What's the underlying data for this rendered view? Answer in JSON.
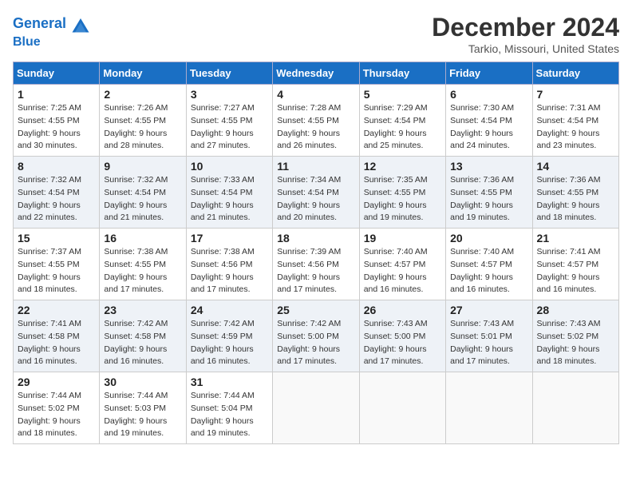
{
  "header": {
    "logo_line1": "General",
    "logo_line2": "Blue",
    "month_title": "December 2024",
    "location": "Tarkio, Missouri, United States"
  },
  "days_of_week": [
    "Sunday",
    "Monday",
    "Tuesday",
    "Wednesday",
    "Thursday",
    "Friday",
    "Saturday"
  ],
  "weeks": [
    [
      {
        "day": 1,
        "sunrise": "Sunrise: 7:25 AM",
        "sunset": "Sunset: 4:55 PM",
        "daylight": "Daylight: 9 hours and 30 minutes."
      },
      {
        "day": 2,
        "sunrise": "Sunrise: 7:26 AM",
        "sunset": "Sunset: 4:55 PM",
        "daylight": "Daylight: 9 hours and 28 minutes."
      },
      {
        "day": 3,
        "sunrise": "Sunrise: 7:27 AM",
        "sunset": "Sunset: 4:55 PM",
        "daylight": "Daylight: 9 hours and 27 minutes."
      },
      {
        "day": 4,
        "sunrise": "Sunrise: 7:28 AM",
        "sunset": "Sunset: 4:55 PM",
        "daylight": "Daylight: 9 hours and 26 minutes."
      },
      {
        "day": 5,
        "sunrise": "Sunrise: 7:29 AM",
        "sunset": "Sunset: 4:54 PM",
        "daylight": "Daylight: 9 hours and 25 minutes."
      },
      {
        "day": 6,
        "sunrise": "Sunrise: 7:30 AM",
        "sunset": "Sunset: 4:54 PM",
        "daylight": "Daylight: 9 hours and 24 minutes."
      },
      {
        "day": 7,
        "sunrise": "Sunrise: 7:31 AM",
        "sunset": "Sunset: 4:54 PM",
        "daylight": "Daylight: 9 hours and 23 minutes."
      }
    ],
    [
      {
        "day": 8,
        "sunrise": "Sunrise: 7:32 AM",
        "sunset": "Sunset: 4:54 PM",
        "daylight": "Daylight: 9 hours and 22 minutes."
      },
      {
        "day": 9,
        "sunrise": "Sunrise: 7:32 AM",
        "sunset": "Sunset: 4:54 PM",
        "daylight": "Daylight: 9 hours and 21 minutes."
      },
      {
        "day": 10,
        "sunrise": "Sunrise: 7:33 AM",
        "sunset": "Sunset: 4:54 PM",
        "daylight": "Daylight: 9 hours and 21 minutes."
      },
      {
        "day": 11,
        "sunrise": "Sunrise: 7:34 AM",
        "sunset": "Sunset: 4:54 PM",
        "daylight": "Daylight: 9 hours and 20 minutes."
      },
      {
        "day": 12,
        "sunrise": "Sunrise: 7:35 AM",
        "sunset": "Sunset: 4:55 PM",
        "daylight": "Daylight: 9 hours and 19 minutes."
      },
      {
        "day": 13,
        "sunrise": "Sunrise: 7:36 AM",
        "sunset": "Sunset: 4:55 PM",
        "daylight": "Daylight: 9 hours and 19 minutes."
      },
      {
        "day": 14,
        "sunrise": "Sunrise: 7:36 AM",
        "sunset": "Sunset: 4:55 PM",
        "daylight": "Daylight: 9 hours and 18 minutes."
      }
    ],
    [
      {
        "day": 15,
        "sunrise": "Sunrise: 7:37 AM",
        "sunset": "Sunset: 4:55 PM",
        "daylight": "Daylight: 9 hours and 18 minutes."
      },
      {
        "day": 16,
        "sunrise": "Sunrise: 7:38 AM",
        "sunset": "Sunset: 4:55 PM",
        "daylight": "Daylight: 9 hours and 17 minutes."
      },
      {
        "day": 17,
        "sunrise": "Sunrise: 7:38 AM",
        "sunset": "Sunset: 4:56 PM",
        "daylight": "Daylight: 9 hours and 17 minutes."
      },
      {
        "day": 18,
        "sunrise": "Sunrise: 7:39 AM",
        "sunset": "Sunset: 4:56 PM",
        "daylight": "Daylight: 9 hours and 17 minutes."
      },
      {
        "day": 19,
        "sunrise": "Sunrise: 7:40 AM",
        "sunset": "Sunset: 4:57 PM",
        "daylight": "Daylight: 9 hours and 16 minutes."
      },
      {
        "day": 20,
        "sunrise": "Sunrise: 7:40 AM",
        "sunset": "Sunset: 4:57 PM",
        "daylight": "Daylight: 9 hours and 16 minutes."
      },
      {
        "day": 21,
        "sunrise": "Sunrise: 7:41 AM",
        "sunset": "Sunset: 4:57 PM",
        "daylight": "Daylight: 9 hours and 16 minutes."
      }
    ],
    [
      {
        "day": 22,
        "sunrise": "Sunrise: 7:41 AM",
        "sunset": "Sunset: 4:58 PM",
        "daylight": "Daylight: 9 hours and 16 minutes."
      },
      {
        "day": 23,
        "sunrise": "Sunrise: 7:42 AM",
        "sunset": "Sunset: 4:58 PM",
        "daylight": "Daylight: 9 hours and 16 minutes."
      },
      {
        "day": 24,
        "sunrise": "Sunrise: 7:42 AM",
        "sunset": "Sunset: 4:59 PM",
        "daylight": "Daylight: 9 hours and 16 minutes."
      },
      {
        "day": 25,
        "sunrise": "Sunrise: 7:42 AM",
        "sunset": "Sunset: 5:00 PM",
        "daylight": "Daylight: 9 hours and 17 minutes."
      },
      {
        "day": 26,
        "sunrise": "Sunrise: 7:43 AM",
        "sunset": "Sunset: 5:00 PM",
        "daylight": "Daylight: 9 hours and 17 minutes."
      },
      {
        "day": 27,
        "sunrise": "Sunrise: 7:43 AM",
        "sunset": "Sunset: 5:01 PM",
        "daylight": "Daylight: 9 hours and 17 minutes."
      },
      {
        "day": 28,
        "sunrise": "Sunrise: 7:43 AM",
        "sunset": "Sunset: 5:02 PM",
        "daylight": "Daylight: 9 hours and 18 minutes."
      }
    ],
    [
      {
        "day": 29,
        "sunrise": "Sunrise: 7:44 AM",
        "sunset": "Sunset: 5:02 PM",
        "daylight": "Daylight: 9 hours and 18 minutes."
      },
      {
        "day": 30,
        "sunrise": "Sunrise: 7:44 AM",
        "sunset": "Sunset: 5:03 PM",
        "daylight": "Daylight: 9 hours and 19 minutes."
      },
      {
        "day": 31,
        "sunrise": "Sunrise: 7:44 AM",
        "sunset": "Sunset: 5:04 PM",
        "daylight": "Daylight: 9 hours and 19 minutes."
      },
      null,
      null,
      null,
      null
    ]
  ]
}
